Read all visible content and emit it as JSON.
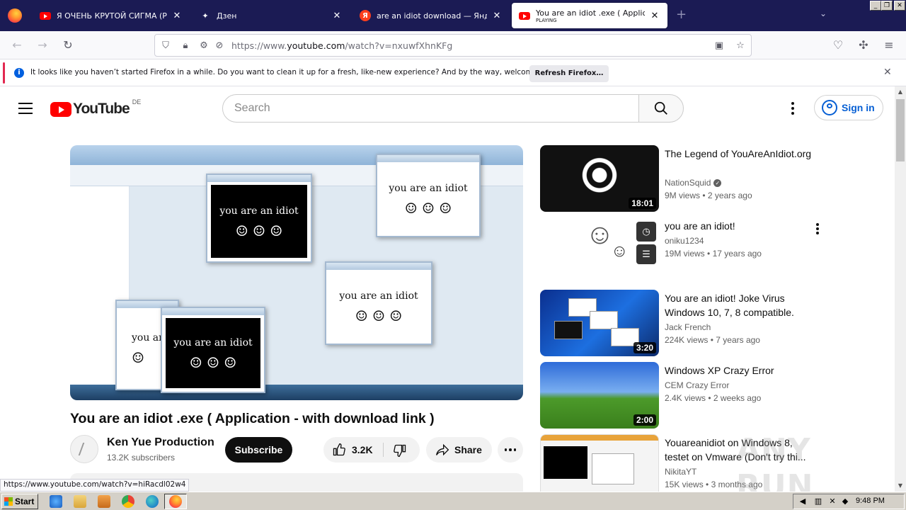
{
  "browser": {
    "tabs": [
      {
        "label": "Я ОЧЕНЬ КРУТОЙ СИГМА (PHONK",
        "icon": "youtube-icon"
      },
      {
        "label": "Дзен",
        "icon": "dzen-icon"
      },
      {
        "label": "are an idiot download — Яндекс: н",
        "icon": "yandex-icon"
      },
      {
        "label": "You are an idiot .exe ( Application",
        "sublabel": "PLAYING",
        "icon": "youtube-icon"
      }
    ],
    "url_prefix": "https://www.",
    "url_domain": "youtube.com",
    "url_path": "/watch?v=nxuwfXhnKFg",
    "notification": {
      "message": "It looks like you haven’t started Firefox in a while. Do you want to clean it up for a fresh, like-new experience? And by the way, welcome back!",
      "button": "Refresh Firefox…"
    },
    "status_url": "https://www.youtube.com/watch?v=hiRacdl02w4"
  },
  "youtube": {
    "logo_text": "YouTube",
    "region": "DE",
    "search_placeholder": "Search",
    "sign_in": "Sign in",
    "video": {
      "title": "You are an idiot .exe ( Application - with download link )",
      "channel": "Ken Yue Production",
      "subscribers": "13.2K subscribers",
      "subscribe_label": "Subscribe",
      "likes": "3.2K",
      "share_label": "Share",
      "description_peek": "ago",
      "frame_text": "you are an idiot",
      "frame_text_cut": "you ar",
      "faces": "☺ ☺ ☺",
      "face_single": "☺"
    },
    "recommendations": [
      {
        "title": "The Legend of YouAreAnIdiot.org",
        "channel": "NationSquid",
        "verified": true,
        "views": "9M views",
        "age": "2 years ago",
        "duration": "18:01"
      },
      {
        "title": "you are an idiot!",
        "channel": "oniku1234",
        "verified": false,
        "views": "19M views",
        "age": "17 years ago",
        "duration": ""
      },
      {
        "title": "You are an idiot! Joke Virus Windows 10, 7, 8 compatible.",
        "channel": "Jack French",
        "verified": false,
        "views": "224K views",
        "age": "7 years ago",
        "duration": "3:20"
      },
      {
        "title": "Windows XP Crazy Error",
        "channel": "CEM Crazy Error",
        "verified": false,
        "views": "2.4K views",
        "age": "2 weeks ago",
        "duration": "2:00"
      },
      {
        "title": "Youareanidiot on Windows 8, testet on Vmware (Don't try thi...",
        "channel": "NikitaYT",
        "verified": false,
        "views": "15K views",
        "age": "3 months ago",
        "duration": ""
      }
    ],
    "meta_sep": "•"
  },
  "watermark": "ANY RUN",
  "taskbar": {
    "start_label": "Start",
    "clock": "9:48 PM"
  }
}
